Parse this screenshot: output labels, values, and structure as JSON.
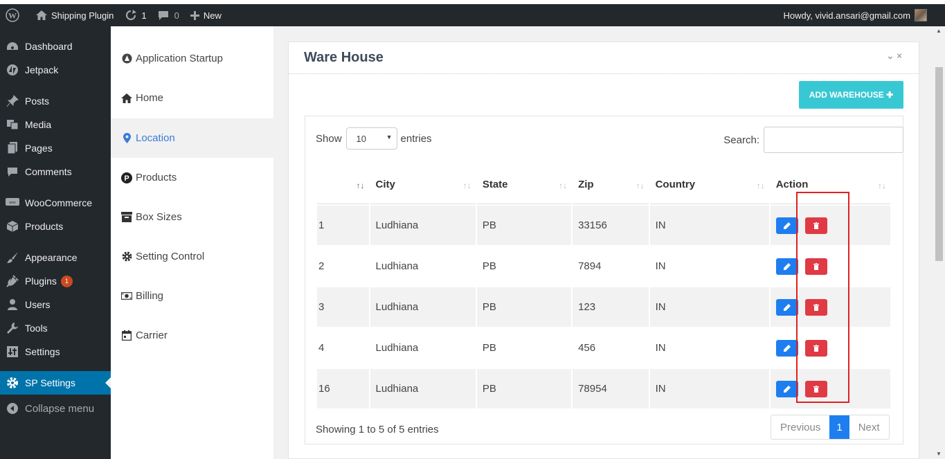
{
  "adminbar": {
    "site_name": "Shipping Plugin",
    "updates_count": "1",
    "comments_count": "0",
    "new_label": "New",
    "howdy": "Howdy, vivid.ansari@gmail.com"
  },
  "wp_menu": {
    "dashboard": "Dashboard",
    "jetpack": "Jetpack",
    "posts": "Posts",
    "media": "Media",
    "pages": "Pages",
    "comments": "Comments",
    "woocommerce": "WooCommerce",
    "products": "Products",
    "appearance": "Appearance",
    "plugins": "Plugins",
    "plugins_badge": "1",
    "users": "Users",
    "tools": "Tools",
    "settings": "Settings",
    "sp_settings": "SP Settings",
    "collapse": "Collapse menu"
  },
  "plugin_nav": {
    "application_startup": "Application Startup",
    "home": "Home",
    "location": "Location",
    "products": "Products",
    "box_sizes": "Box Sizes",
    "setting_control": "Setting Control",
    "billing": "Billing",
    "carrier": "Carrier"
  },
  "card": {
    "title": "Ware House",
    "add_button": "ADD WAREHOUSE ✚"
  },
  "table": {
    "show_label": "Show",
    "entries_value": "10",
    "entries_label": "entries",
    "search_label": "Search:",
    "columns": [
      "",
      "City",
      "State",
      "Zip",
      "Country",
      "Action"
    ],
    "rows": [
      {
        "id": "1",
        "city": "Ludhiana",
        "state": "PB",
        "zip": "33156",
        "country": "IN"
      },
      {
        "id": "2",
        "city": "Ludhiana",
        "state": "PB",
        "zip": "7894",
        "country": "IN"
      },
      {
        "id": "3",
        "city": "Ludhiana",
        "state": "PB",
        "zip": "123",
        "country": "IN"
      },
      {
        "id": "4",
        "city": "Ludhiana",
        "state": "PB",
        "zip": "456",
        "country": "IN"
      },
      {
        "id": "16",
        "city": "Ludhiana",
        "state": "PB",
        "zip": "78954",
        "country": "IN"
      }
    ],
    "info": "Showing 1 to 5 of 5 entries",
    "previous": "Previous",
    "current_page": "1",
    "next": "Next"
  },
  "colors": {
    "accent_cyan": "#38c8d4",
    "edit_blue": "#1e7ef0",
    "delete_red": "#e03a45",
    "highlight_box": "#e02020"
  }
}
